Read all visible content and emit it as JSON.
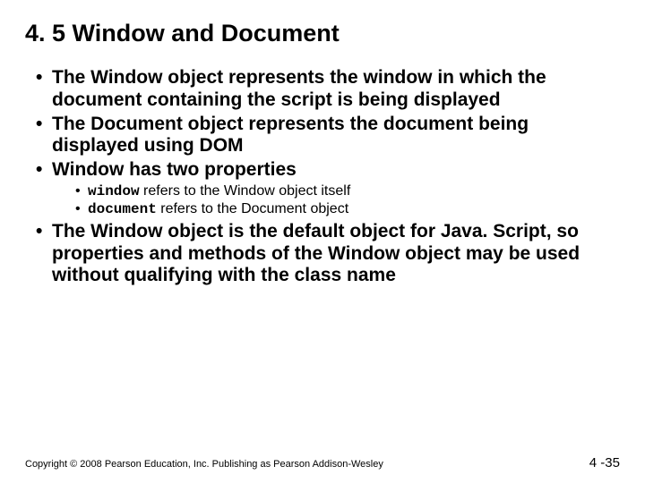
{
  "title": "4. 5 Window and Document",
  "bullets": {
    "b1": "The Window object represents the window in which the document containing the script is being displayed",
    "b2": "The Document object represents the document being displayed using DOM",
    "b3": "Window has two properties",
    "b3a_code": "window",
    "b3a_rest": " refers to the Window object itself",
    "b3b_code": "document",
    "b3b_rest": " refers to the Document object",
    "b4": "The Window object is the default object for Java. Script, so properties and methods of the Window object may be used without qualifying with the class name"
  },
  "footer": {
    "copyright": "Copyright © 2008 Pearson Education, Inc. Publishing as Pearson Addison-Wesley",
    "page": "4 -35"
  }
}
